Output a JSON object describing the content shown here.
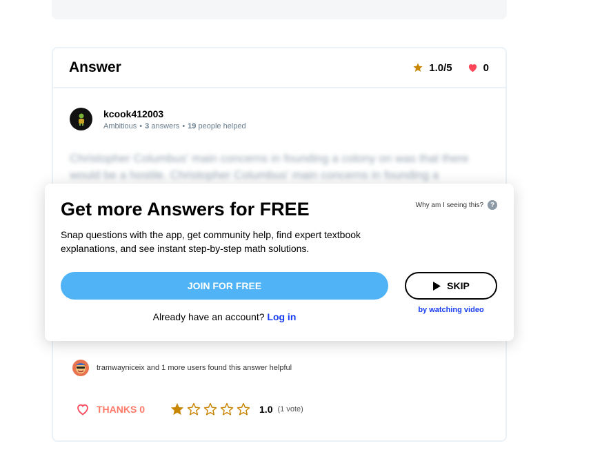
{
  "answer": {
    "title": "Answer",
    "rating": "1.0/5",
    "likes": "0"
  },
  "author": {
    "name": "kcook412003",
    "rank": "Ambitious",
    "answers_count": "3",
    "answers_label": "answers",
    "helped_count": "19",
    "helped_label": "people helped"
  },
  "content": {
    "blurred_text": "Christopher Columbus' main concerns in founding a colony on was that there would be a hostile. Christopher Columbus' main concerns in founding a"
  },
  "modal": {
    "title": "Get more Answers for FREE",
    "why_label": "Why am I seeing this?",
    "help_icon": "?",
    "description": "Snap questions with the app, get community help, find expert textbook explanations, and see instant step-by-step math solutions.",
    "join_label": "JOIN FOR FREE",
    "skip_label": "SKIP",
    "skip_sub": "by watching video",
    "login_prompt": "Already have an account?",
    "login_link": "Log in"
  },
  "helpful": {
    "text": "tramwayniceix and 1 more users found this answer helpful"
  },
  "footer": {
    "thanks_label": "THANKS 0",
    "rating_value": "1.0",
    "rating_votes": "(1 vote)",
    "stars_filled": 1,
    "stars_total": 5
  },
  "colors": {
    "star": "#c98600",
    "heart": "#ff4658",
    "thanks": "#ff7968",
    "primary_button": "#4fb3f6",
    "link": "#163bf3",
    "border": "#ebf2f7",
    "meta_text": "#687b8c"
  },
  "icons": {
    "rating": "star-icon",
    "likes": "heart-icon",
    "skip": "play-icon",
    "thanks": "heart-outline-icon",
    "help": "question-icon"
  }
}
